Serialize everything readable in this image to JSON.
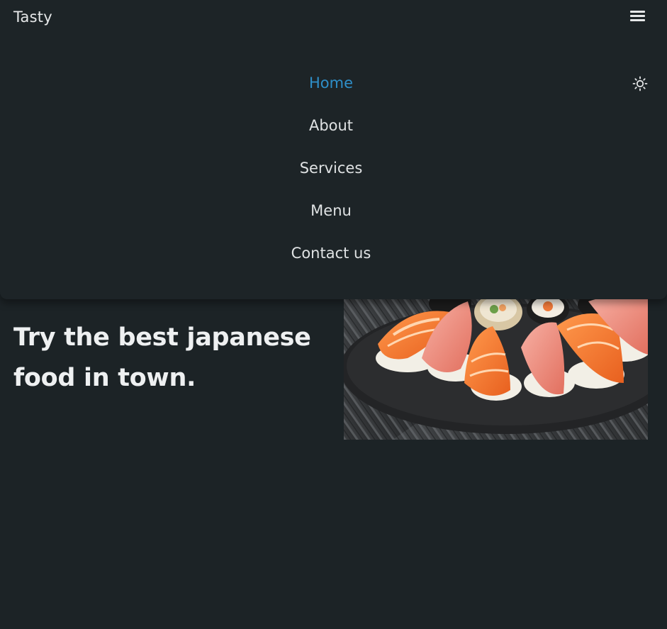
{
  "header": {
    "logo": "Tasty",
    "menu_icon": "hamburger-menu-icon"
  },
  "nav": {
    "items": [
      {
        "label": "Home",
        "active": true
      },
      {
        "label": "About",
        "active": false
      },
      {
        "label": "Services",
        "active": false
      },
      {
        "label": "Menu",
        "active": false
      },
      {
        "label": "Contact us",
        "active": false
      }
    ],
    "theme_icon": "sun-icon",
    "active_color": "#2e8fc9"
  },
  "hero": {
    "title": "Try the best japanese food in town.",
    "image": "sushi-platter-image"
  },
  "colors": {
    "background": "#1c2326",
    "text": "#e3e6e7",
    "accent": "#2e8fc9"
  }
}
